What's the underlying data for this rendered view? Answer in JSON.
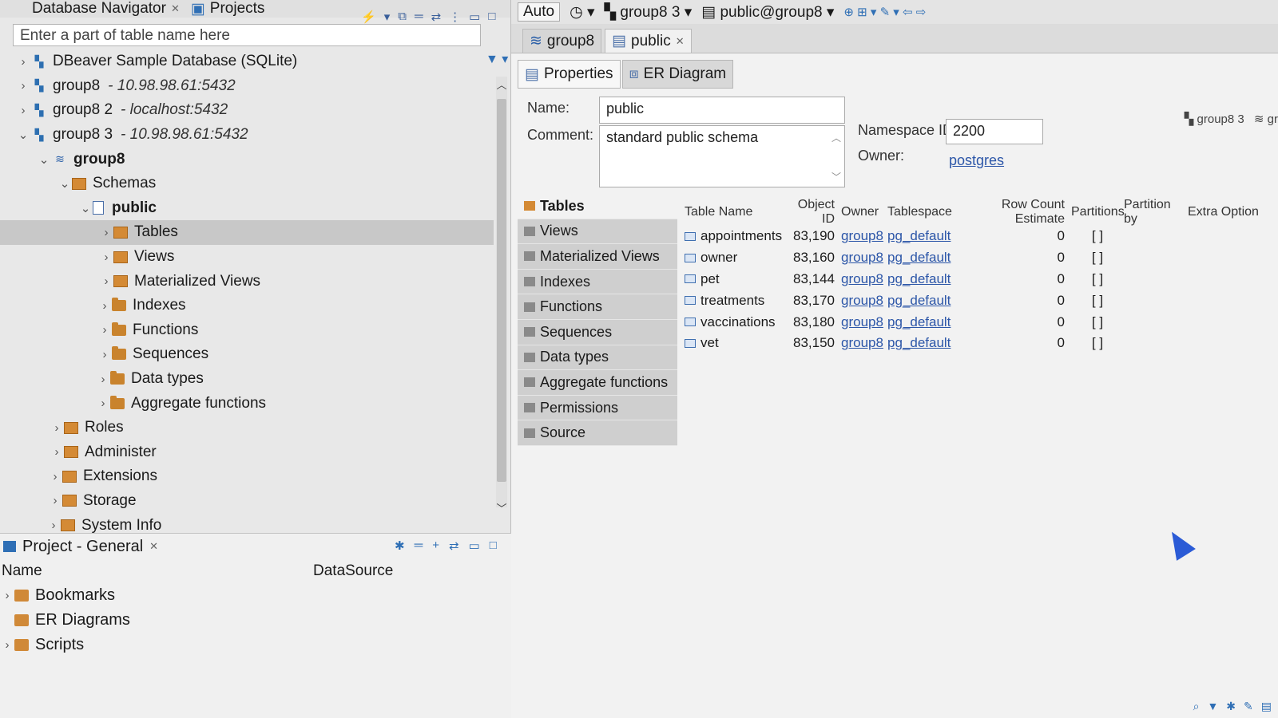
{
  "nav": {
    "tab_navigator": "Database Navigator",
    "tab_projects": "Projects",
    "filter_placeholder": "Enter a part of table name here",
    "connections": [
      {
        "name": "DBeaver Sample Database (SQLite)",
        "host": ""
      },
      {
        "name": "group8",
        "host": "- 10.98.98.61:5432"
      },
      {
        "name": "group8 2",
        "host": "- localhost:5432"
      },
      {
        "name": "group8 3",
        "host": "- 10.98.98.61:5432"
      }
    ],
    "database": "group8",
    "schemas": "Schemas",
    "schema": "public",
    "schema_children": [
      "Tables",
      "Views",
      "Materialized Views",
      "Indexes",
      "Functions",
      "Sequences",
      "Data types",
      "Aggregate functions"
    ],
    "db_children": [
      "Roles",
      "Administer",
      "Extensions",
      "Storage",
      "System Info"
    ]
  },
  "project": {
    "title": "Project - General",
    "col_name": "Name",
    "col_datasource": "DataSource",
    "items": [
      "Bookmarks",
      "ER Diagrams",
      "Scripts"
    ]
  },
  "toolbar": {
    "mode": "Auto",
    "connection": "group8 3",
    "schema_selector": "public@group8"
  },
  "editor_tabs": [
    "group8",
    "public"
  ],
  "sub_tabs": [
    "Properties",
    "ER Diagram"
  ],
  "props": {
    "name_label": "Name:",
    "name_value": "public",
    "comment_label": "Comment:",
    "comment_value": "standard public schema",
    "nsid_label": "Namespace ID:",
    "nsid_value": "2200",
    "owner_label": "Owner:",
    "owner_value": "postgres",
    "conn_indicator": "group8 3",
    "conn_indicator_2": "gr"
  },
  "obj_types": [
    "Tables",
    "Views",
    "Materialized Views",
    "Indexes",
    "Functions",
    "Sequences",
    "Data types",
    "Aggregate functions",
    "Permissions",
    "Source"
  ],
  "grid": {
    "headers": [
      "Table Name",
      "Object ID",
      "Owner",
      "Tablespace",
      "Row Count Estimate",
      "Partitions",
      "Partition by",
      "Extra Option"
    ],
    "rows": [
      {
        "name": "appointments",
        "oid": "83,190",
        "owner": "group8",
        "ts": "pg_default",
        "rc": "0",
        "part": "[ ]"
      },
      {
        "name": "owner",
        "oid": "83,160",
        "owner": "group8",
        "ts": "pg_default",
        "rc": "0",
        "part": "[ ]"
      },
      {
        "name": "pet",
        "oid": "83,144",
        "owner": "group8",
        "ts": "pg_default",
        "rc": "0",
        "part": "[ ]"
      },
      {
        "name": "treatments",
        "oid": "83,170",
        "owner": "group8",
        "ts": "pg_default",
        "rc": "0",
        "part": "[ ]"
      },
      {
        "name": "vaccinations",
        "oid": "83,180",
        "owner": "group8",
        "ts": "pg_default",
        "rc": "0",
        "part": "[ ]"
      },
      {
        "name": "vet",
        "oid": "83,150",
        "owner": "group8",
        "ts": "pg_default",
        "rc": "0",
        "part": "[ ]"
      }
    ]
  }
}
